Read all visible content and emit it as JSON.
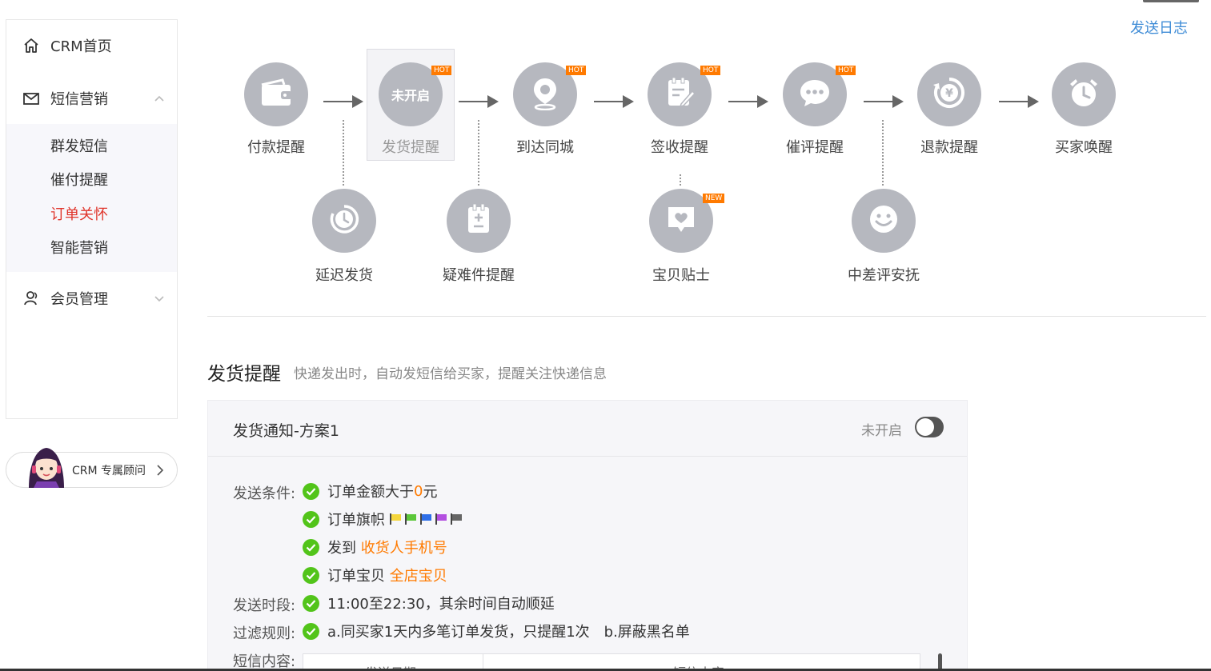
{
  "sidebar": {
    "items": [
      {
        "label": "CRM首页",
        "icon": "home-icon"
      },
      {
        "label": "短信营销",
        "icon": "mail-icon",
        "expanded": true
      },
      {
        "label": "会员管理",
        "icon": "user-icon",
        "expanded": false
      }
    ],
    "submenu": [
      {
        "label": "群发短信"
      },
      {
        "label": "催付提醒"
      },
      {
        "label": "订单关怀",
        "active": true
      },
      {
        "label": "智能营销"
      }
    ],
    "advisor": {
      "label": "CRM 专属顾问"
    }
  },
  "header": {
    "send_log": "发送日志"
  },
  "flow": {
    "main": [
      {
        "label": "付款提醒",
        "icon": "wallet-icon",
        "badge": ""
      },
      {
        "label": "发货提醒",
        "icon": "disabled-text",
        "badge": "HOT",
        "node_text": "未开启",
        "selected": true
      },
      {
        "label": "到达同城",
        "icon": "location-icon",
        "badge": "HOT"
      },
      {
        "label": "签收提醒",
        "icon": "sign-icon",
        "badge": "HOT"
      },
      {
        "label": "催评提醒",
        "icon": "chat-icon",
        "badge": "HOT"
      },
      {
        "label": "退款提醒",
        "icon": "refund-icon",
        "badge": ""
      },
      {
        "label": "买家唤醒",
        "icon": "alarm-icon",
        "badge": ""
      }
    ],
    "secondary": [
      {
        "label": "延迟发货",
        "icon": "clock-icon",
        "badge": ""
      },
      {
        "label": "疑难件提醒",
        "icon": "clipboard-icon",
        "badge": ""
      },
      {
        "label": "宝贝贴士",
        "icon": "heart-message-icon",
        "badge": "NEW"
      },
      {
        "label": "中差评安抚",
        "icon": "smile-icon",
        "badge": ""
      }
    ]
  },
  "section": {
    "title": "发货提醒",
    "desc": "快递发出时，自动发短信给买家，提醒关注快递信息"
  },
  "card": {
    "title": "发货通知-方案1",
    "status": "未开启",
    "send_conditions_label": "发送条件:",
    "cond1_prefix": "订单金额大于",
    "cond1_value": "0",
    "cond1_suffix": "元",
    "cond2": "订单旗帜",
    "flag_colors": [
      "#f5d63d",
      "#5cc73a",
      "#2f6fe8",
      "#b34fe0",
      "#666666"
    ],
    "cond3_prefix": "发到",
    "cond3_value": "收货人手机号",
    "cond4_prefix": "订单宝贝",
    "cond4_value": "全店宝贝",
    "time_label": "发送时段:",
    "time_value": "11:00至22:30，其余时间自动顺延",
    "filter_label": "过滤规则:",
    "filter_a": "a.同买家1天内多笔订单发货，只提醒1次",
    "filter_b": "b.屏蔽黑名单",
    "content_label": "短信内容:",
    "table_headers": [
      "发送日期",
      "短信内容"
    ]
  },
  "colors": {
    "accent": "#3d8bd6",
    "active": "#e0352b",
    "highlight": "#ff7a00",
    "check": "#52c41a",
    "node": "#b6b8bf"
  }
}
